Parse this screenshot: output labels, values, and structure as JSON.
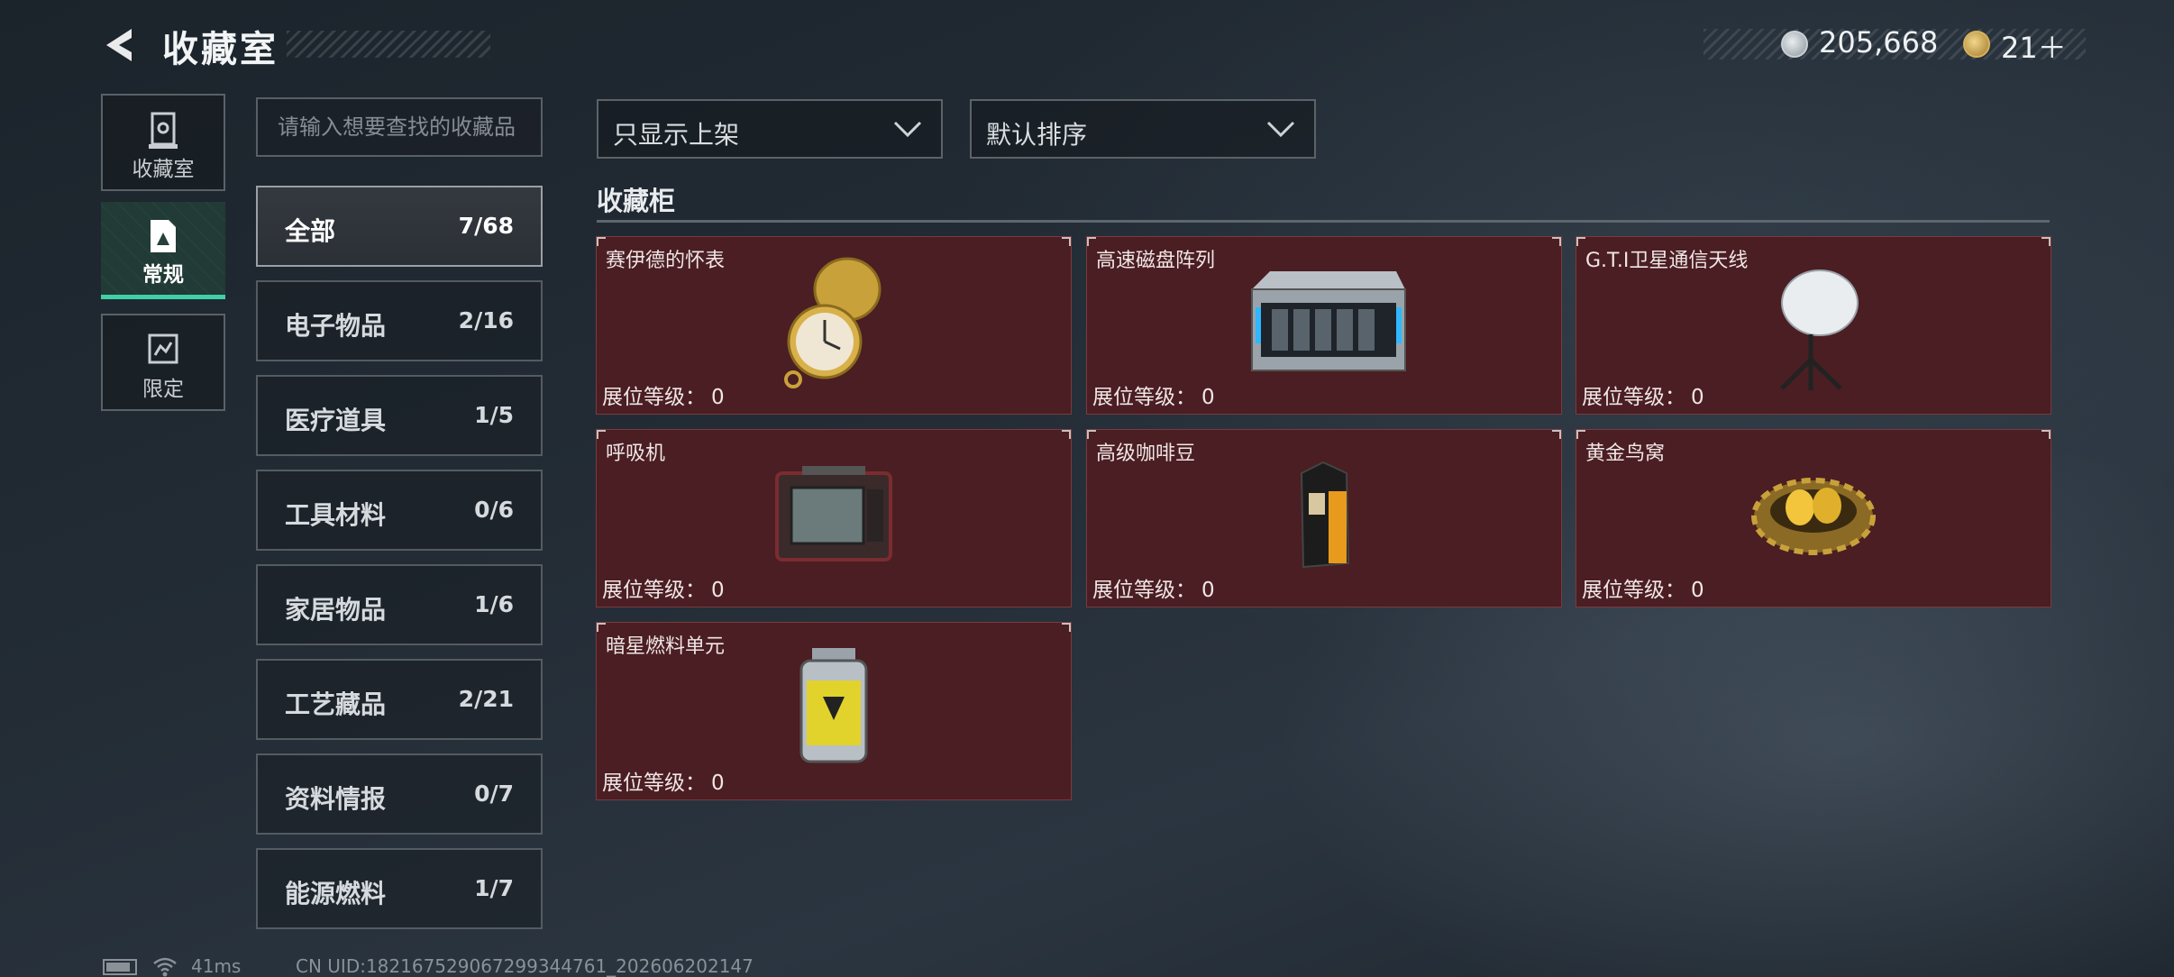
{
  "header": {
    "title": "收藏室",
    "currency": {
      "coin_value": "205,668",
      "gold_value": "21＋",
      "coin_icon": "silver-coin-icon",
      "gold_icon": "gold-coin-icon"
    }
  },
  "nav": {
    "collection_label": "收藏室",
    "regular_label": "常规",
    "limited_label": "限定"
  },
  "search": {
    "placeholder": "请输入想要查找的收藏品"
  },
  "categories": [
    {
      "name": "全部",
      "count": "7/68",
      "active": true
    },
    {
      "name": "电子物品",
      "count": "2/16"
    },
    {
      "name": "医疗道具",
      "count": "1/5"
    },
    {
      "name": "工具材料",
      "count": "0/6"
    },
    {
      "name": "家居物品",
      "count": "1/6"
    },
    {
      "name": "工艺藏品",
      "count": "2/21"
    },
    {
      "name": "资料情报",
      "count": "0/7"
    },
    {
      "name": "能源燃料",
      "count": "1/7"
    }
  ],
  "filters": {
    "show_listed": "只显示上架",
    "sort": "默认排序"
  },
  "section": {
    "title": "收藏柜"
  },
  "level_label": "展位等级：",
  "items": [
    {
      "name": "赛伊德的怀表",
      "level": "0"
    },
    {
      "name": "高速磁盘阵列",
      "level": "0"
    },
    {
      "name": "G.T.I卫星通信天线",
      "level": "0"
    },
    {
      "name": "呼吸机",
      "level": "0"
    },
    {
      "name": "高级咖啡豆",
      "level": "0"
    },
    {
      "name": "黄金鸟窝",
      "level": "0"
    },
    {
      "name": "暗星燃料单元",
      "level": "0"
    }
  ],
  "footer": {
    "ping": "41ms",
    "uid": "CN UID:18216752906729934476​1_202606202147"
  },
  "colors": {
    "accent": "#3fd0a6",
    "card_bg": "#4a1e22"
  }
}
